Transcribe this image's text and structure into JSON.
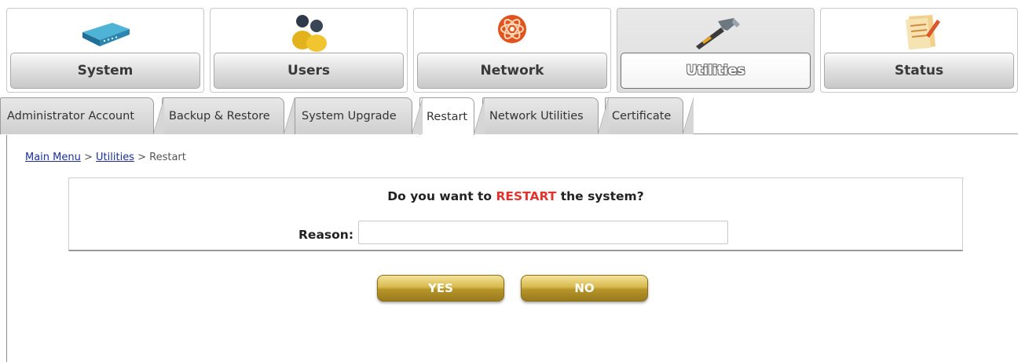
{
  "topnav": {
    "items": [
      {
        "label": "System",
        "icon": "router-icon",
        "active": false
      },
      {
        "label": "Users",
        "icon": "users-icon",
        "active": false
      },
      {
        "label": "Network",
        "icon": "network-icon",
        "active": false
      },
      {
        "label": "Utilities",
        "icon": "hammer-icon",
        "active": true
      },
      {
        "label": "Status",
        "icon": "notepad-icon",
        "active": false
      }
    ]
  },
  "subtabs": [
    {
      "label": "Administrator Account",
      "active": false
    },
    {
      "label": "Backup & Restore",
      "active": false
    },
    {
      "label": "System Upgrade",
      "active": false
    },
    {
      "label": "Restart",
      "active": true
    },
    {
      "label": "Network Utilities",
      "active": false
    },
    {
      "label": "Certificate",
      "active": false
    }
  ],
  "breadcrumb": {
    "main_menu": "Main Menu",
    "sep1": " > ",
    "utilities": "Utilities",
    "sep2": " > ",
    "current": "Restart"
  },
  "dialog": {
    "question_prefix": "Do you want to ",
    "question_highlight": "RESTART",
    "question_suffix": " the system?",
    "reason_label": "Reason:",
    "reason_value": ""
  },
  "buttons": {
    "yes": "YES",
    "no": "NO"
  },
  "colors": {
    "highlight": "#e2342e",
    "link": "#1a2f9a",
    "button_gold": "#c9a63a"
  }
}
